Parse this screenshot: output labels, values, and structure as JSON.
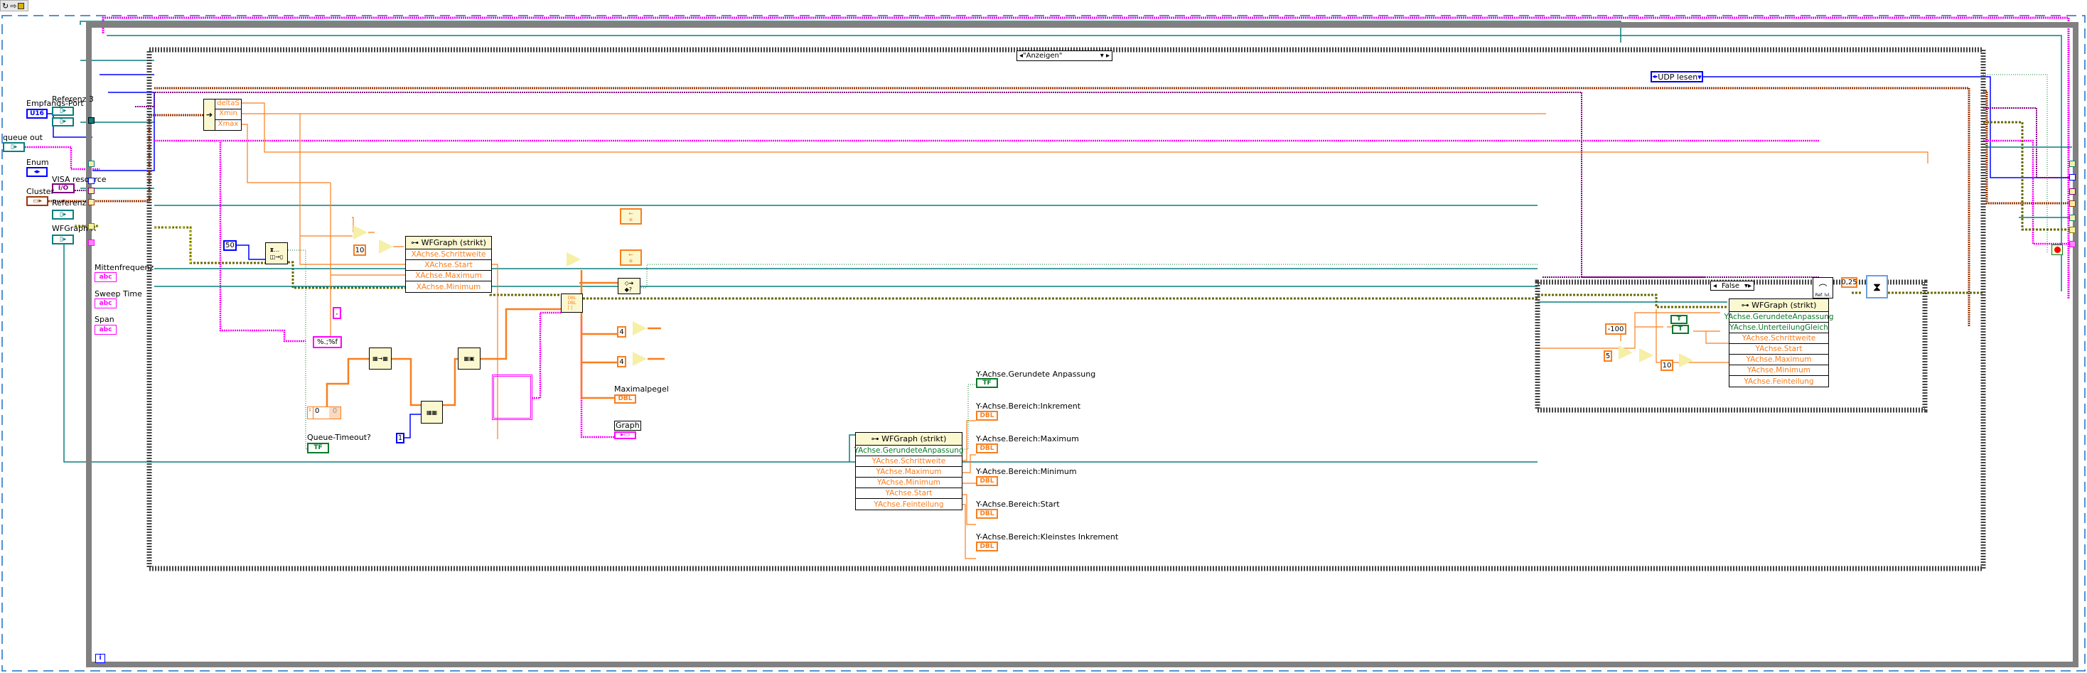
{
  "toolbar": {
    "icons": [
      "run-icon",
      "arrow-icon",
      "highlight-icon"
    ]
  },
  "loop": {
    "iteration_label": "i"
  },
  "case_outer": {
    "selector": "\"Anzeigen\""
  },
  "case_inner": {
    "selector": "False"
  },
  "controls_left": [
    {
      "label": "Empfangs-Port",
      "type": "U16"
    },
    {
      "label": "Referenz 3",
      "type": "ref"
    },
    {
      "label": "queue out",
      "type": "ref"
    },
    {
      "label": "Enum",
      "type": "enum"
    },
    {
      "label": "VISA resource",
      "type": "I/O"
    },
    {
      "label": "Cluster",
      "type": "cluster"
    },
    {
      "label": "Referenz 2",
      "type": "ref"
    },
    {
      "label": "WFGraph R",
      "type": "ref"
    }
  ],
  "string_indicators": [
    {
      "label": "Mittenfrequenz",
      "type": "abc"
    },
    {
      "label": "Sweep Time",
      "type": "abc"
    },
    {
      "label": "Span",
      "type": "abc"
    }
  ],
  "unbundle": {
    "fields": [
      "deltaS",
      "Xmin",
      "Xmax"
    ]
  },
  "constants": {
    "timeout": "50",
    "divisor": "10",
    "comma": ",",
    "format": "%.;%f",
    "array_zero": "0",
    "array_elem": "0",
    "index_one": "1",
    "four_a": "4",
    "four_b": "4",
    "minus100": "-100",
    "five": "5",
    "ten_inner": "10",
    "wait": "0,25",
    "enum_next": "UDP lesen"
  },
  "x_property_node": {
    "title": "WFGraph (strikt)",
    "rows": [
      "XAchse.Schrittweite",
      "XAchse.Start",
      "XAchse.Maximum",
      "XAchse.Minimum"
    ]
  },
  "queue_timeout": {
    "label": "Queue-Timeout?",
    "type": "TF"
  },
  "max_level": {
    "label": "Maximalpegel",
    "type": "DBL"
  },
  "graph": {
    "label": "Graph"
  },
  "y_property_node": {
    "title": "WFGraph (strikt)",
    "rows": [
      "YAchse.GerundeteAnpassung",
      "YAchse.Schrittweite",
      "YAchse.Maximum",
      "YAchse.Minimum",
      "YAchse.Start",
      "YAchse.Feinteilung"
    ]
  },
  "y_indicators": [
    {
      "label": "Y-Achse.Gerundete Anpassung",
      "type": "TF"
    },
    {
      "label": "Y-Achse.Bereich:Inkrement",
      "type": "DBL"
    },
    {
      "label": "Y-Achse.Bereich:Maximum",
      "type": "DBL"
    },
    {
      "label": "Y-Achse.Bereich:Minimum",
      "type": "DBL"
    },
    {
      "label": "Y-Achse.Bereich:Start",
      "type": "DBL"
    },
    {
      "label": "Y-Achse.Bereich:Kleinstes Inkrement",
      "type": "DBL"
    }
  ],
  "inner_property_node": {
    "title": "WFGraph (strikt)",
    "rows": [
      "YAchse.GerundeteAnpassung",
      "YAchse.UnterteilungGleich",
      "YAchse.Schrittweite",
      "YAchse.Start",
      "YAchse.Maximum",
      "YAchse.Minimum",
      "YAchse.Feinteilung"
    ]
  },
  "bool_true": "T",
  "ref_lvl": "Ref. lvl.",
  "colors": {
    "orange": "#f97e1d",
    "pink": "#ff00ff",
    "teal": "#0a7f7f",
    "blue": "#0000ff",
    "brown": "#9a3a0a",
    "purple": "#800080",
    "olive": "#808000",
    "green": "#0a7a2a"
  }
}
